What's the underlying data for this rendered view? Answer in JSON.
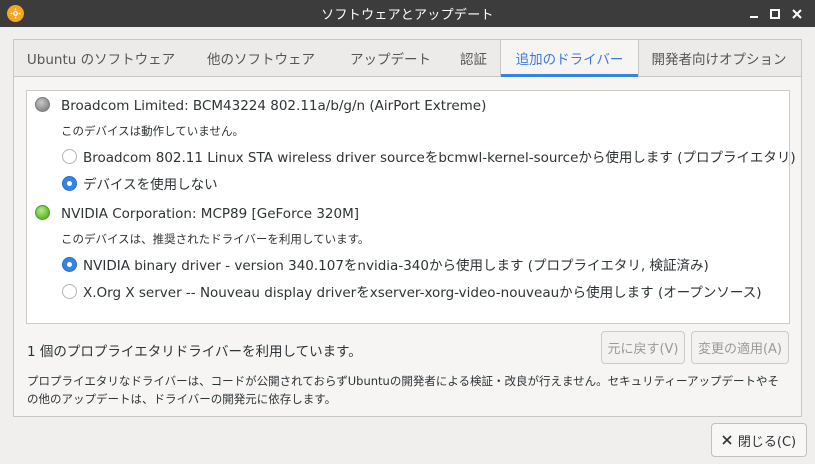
{
  "window": {
    "title": "ソフトウェアとアップデート"
  },
  "icons": {
    "app": "gear-icon",
    "minimize": "minimize-icon",
    "maximize": "maximize-icon",
    "close": "close-icon"
  },
  "tabs": [
    {
      "label": "Ubuntu のソフトウェア",
      "active": false
    },
    {
      "label": "他のソフトウェア",
      "active": false
    },
    {
      "label": "アップデート",
      "active": false
    },
    {
      "label": "認証",
      "active": false
    },
    {
      "label": "追加のドライバー",
      "active": true
    },
    {
      "label": "開発者向けオプション",
      "active": false
    }
  ],
  "devices": [
    {
      "name": "Broadcom Limited: BCM43224 802.11a/b/g/n (AirPort Extreme)",
      "status": "このデバイスは動作していません。",
      "status_color": "gray",
      "options": [
        {
          "label": "Broadcom 802.11 Linux STA wireless driver sourceをbcmwl-kernel-sourceから使用します (プロプライエタリ)",
          "selected": false
        },
        {
          "label": "デバイスを使用しない",
          "selected": true
        }
      ]
    },
    {
      "name": "NVIDIA Corporation: MCP89 [GeForce 320M]",
      "status": "このデバイスは、推奨されたドライバーを利用しています。",
      "status_color": "green",
      "options": [
        {
          "label": "NVIDIA binary driver - version 340.107をnvidia-340から使用します (プロプライエタリ, 検証済み)",
          "selected": true
        },
        {
          "label": "X.Org X server -- Nouveau display driverをxserver-xorg-video-nouveauから使用します (オープンソース)",
          "selected": false
        }
      ]
    }
  ],
  "summary": "1 個のプロプライエタリドライバーを利用しています。",
  "buttons": {
    "revert": "元に戻す(V)",
    "apply": "変更の適用(A)",
    "close": "閉じる(C)"
  },
  "notice": "プロプライエタリなドライバーは、コードが公開されておらずUbuntuの開発者による検証・改良が行えません。セキュリティーアップデートやその他のアップデートは、ドライバーの開発元に依存します。",
  "colors": {
    "accent": "#3584e4",
    "titlebar": "#3c3c3c",
    "app_icon": "#f5a623"
  }
}
